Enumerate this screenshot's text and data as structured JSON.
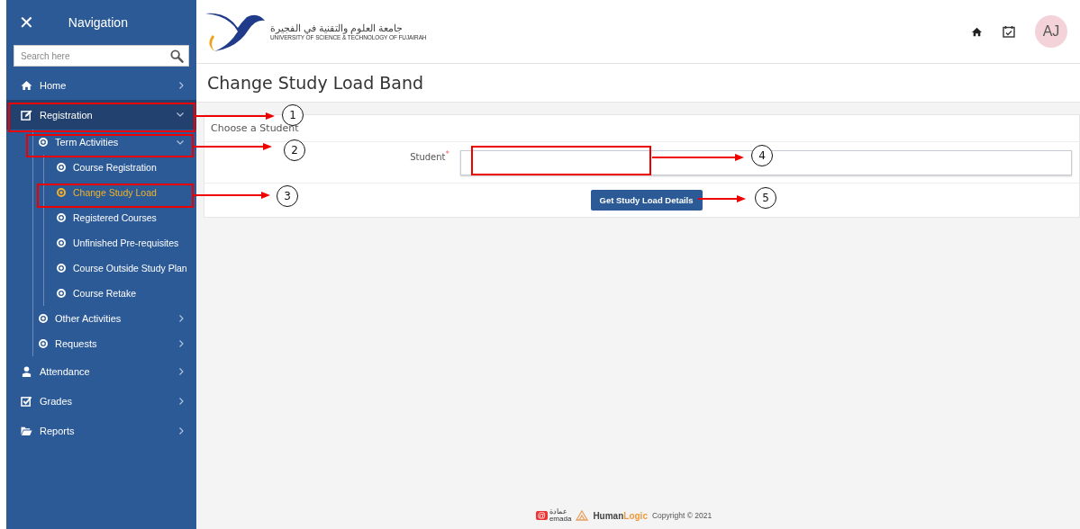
{
  "sidebar": {
    "title": "Navigation",
    "close": "✕",
    "search": {
      "placeholder": "Search here"
    },
    "items": [
      {
        "label": "Home",
        "expanded": false,
        "selected": false
      },
      {
        "label": "Registration",
        "expanded": true,
        "selected": true,
        "children": [
          {
            "label": "Term Activities",
            "expanded": true,
            "children": [
              {
                "label": "Course Registration",
                "selected": false
              },
              {
                "label": "Change Study Load",
                "selected": true
              },
              {
                "label": "Registered Courses",
                "selected": false
              },
              {
                "label": "Unfinished Pre-requisites",
                "selected": false
              },
              {
                "label": "Course Outside Study Plan",
                "selected": false
              },
              {
                "label": "Course Retake",
                "selected": false
              }
            ]
          },
          {
            "label": "Other Activities",
            "expanded": false
          },
          {
            "label": "Requests",
            "expanded": false
          }
        ]
      },
      {
        "label": "Attendance",
        "expanded": false,
        "selected": false
      },
      {
        "label": "Grades",
        "expanded": false,
        "selected": false
      },
      {
        "label": "Reports",
        "expanded": false,
        "selected": false
      }
    ]
  },
  "header": {
    "logo_arabic": "جامعة العلوم والتقنية في الفجيرة",
    "logo_english": "UNIVERSITY OF SCIENCE & TECHNOLOGY OF FUJAIRAH",
    "avatar": "AJ"
  },
  "page": {
    "title": "Change Study Load Band",
    "section": "Choose a Student",
    "field": {
      "label": "Student",
      "required_mark": "*"
    },
    "button": "Get Study Load Details"
  },
  "footer": {
    "emada_icon": "@",
    "emada_arabic": "عمادة",
    "emada": "emada",
    "brand_human": "Human",
    "brand_logic": "Logic",
    "copyright": "Copyright © 2021"
  },
  "annotations": [
    "1",
    "2",
    "3",
    "4",
    "5"
  ]
}
